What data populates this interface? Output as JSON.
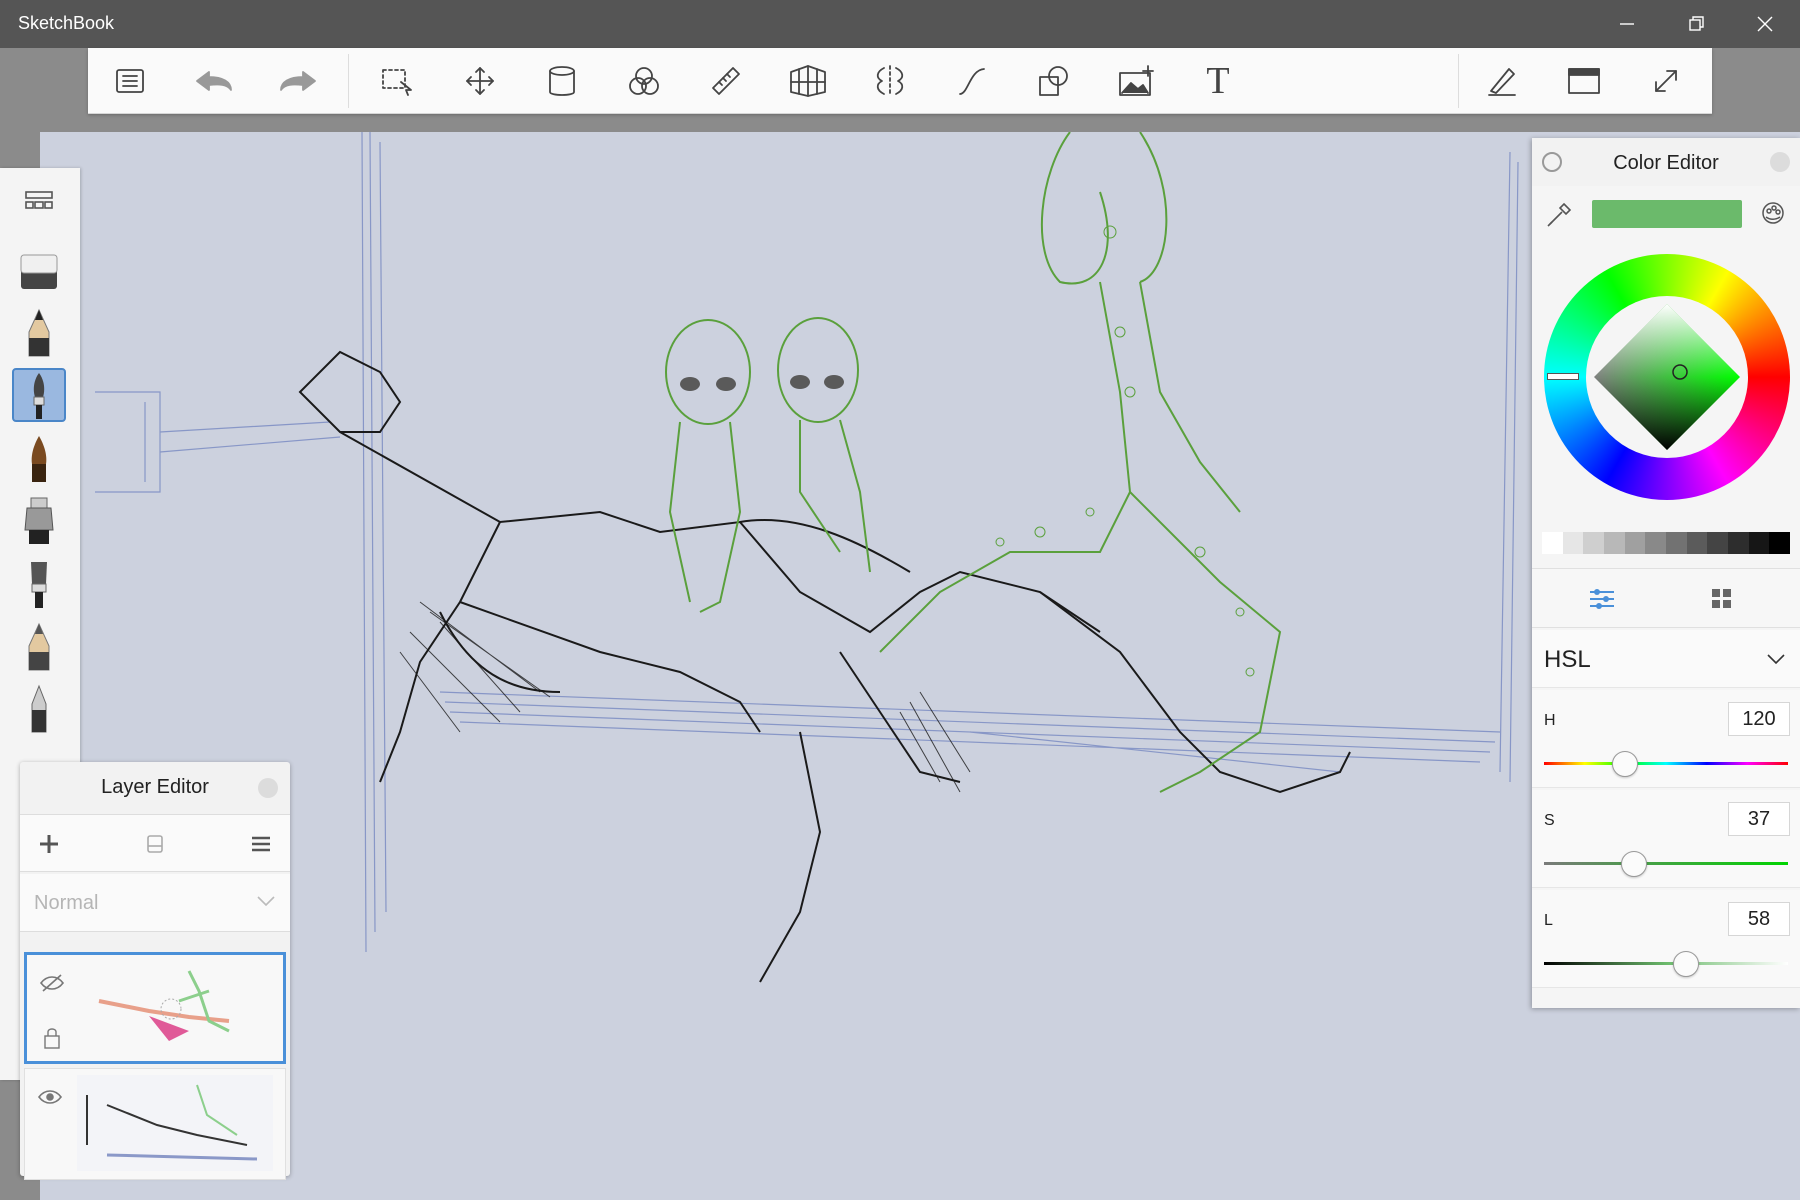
{
  "window": {
    "title": "SketchBook",
    "controls": [
      "minimize-icon",
      "restore-icon",
      "close-icon"
    ]
  },
  "toolbar": {
    "tools": [
      "list-icon",
      "undo-icon",
      "redo-icon",
      "select-icon",
      "move-icon",
      "fill-icon",
      "color-blend-icon",
      "ruler-icon",
      "perspective-icon",
      "symmetry-icon",
      "curve-icon",
      "shape-icon",
      "add-image-icon",
      "text-icon",
      "pen-icon",
      "window-icon",
      "fullscreen-icon"
    ],
    "text_tool_label": "T"
  },
  "brush_palette": {
    "brushes": [
      "eraser",
      "pencil",
      "brush-selected",
      "marker",
      "airbrush",
      "flat-brush",
      "hard-pencil",
      "ballpoint"
    ],
    "selected_index": 2
  },
  "layer_editor": {
    "title": "Layer Editor",
    "blend_mode": "Normal",
    "layers": [
      {
        "visible": false,
        "active": true,
        "locked": true
      },
      {
        "visible": true,
        "active": false,
        "locked": false
      }
    ]
  },
  "color_editor": {
    "title": "Color Editor",
    "current_color": "#6bba6b",
    "mode": "HSL",
    "sliders": [
      {
        "label": "H",
        "value": "120",
        "fraction": 0.33
      },
      {
        "label": "S",
        "value": "37",
        "fraction": 0.37
      },
      {
        "label": "L",
        "value": "58",
        "fraction": 0.58
      }
    ],
    "grays": [
      "#ffffff",
      "#e6e6e6",
      "#cfcfcf",
      "#b8b8b8",
      "#a0a0a0",
      "#898989",
      "#727272",
      "#5b5b5b",
      "#444444",
      "#2d2d2d",
      "#161616",
      "#000000"
    ]
  },
  "colors": {
    "canvas": "#ccd1de",
    "accent": "#4a90d9",
    "sketch_green": "#5aa03c",
    "sketch_black": "#1a1a1a",
    "sketch_blue": "#5a6fb8"
  }
}
